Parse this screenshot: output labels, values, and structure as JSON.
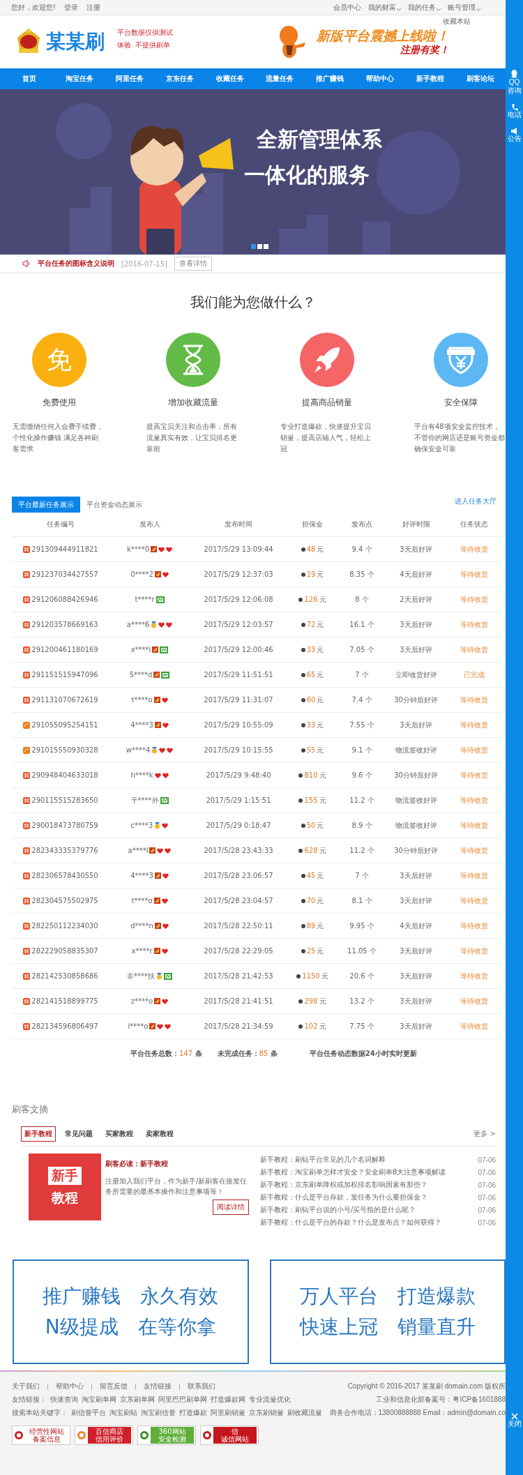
{
  "top_bar": {
    "greeting": "您好，欢迎您!",
    "links": [
      "登录",
      "注册"
    ],
    "menus": [
      {
        "label": "会员中心",
        "dropdown": false
      },
      {
        "label": "我的财富",
        "dropdown": true
      },
      {
        "label": "我的任务",
        "dropdown": true
      },
      {
        "label": "账号管理",
        "dropdown": true
      }
    ],
    "bookmark": "收藏本站"
  },
  "header": {
    "logo": "某某刷",
    "notes": [
      "平台数据仅供测试",
      "体验  不提供刷单"
    ],
    "ad_title": "新版平台震撼上线啦！",
    "ad_subtitle": "注册有奖！"
  },
  "nav": [
    "首页",
    "淘宝任务",
    "阿里任务",
    "京东任务",
    "收藏任务",
    "流量任务",
    "推广赚钱",
    "帮助中心",
    "新手教程",
    "刷客论坛"
  ],
  "hero": {
    "kind": "picture",
    "lines": [
      "全新管理体系",
      "一体化的服务"
    ],
    "slides": [
      {
        "selected": true
      },
      {
        "selected": false
      },
      {
        "selected": false
      }
    ]
  },
  "notice": {
    "title": "平台任务的图标含义说明",
    "date": "[2016-07-15]",
    "button": "查看详情"
  },
  "services": {
    "heading": "我们能为您做什么？",
    "items": [
      {
        "kind": "glyph",
        "glyph": "免",
        "color": "#fbb00f",
        "title": "免费使用",
        "text": "无需缴纳任何入会费手续费，个性化操作赚钱 满足各种刷客需求"
      },
      {
        "kind": "hourglass",
        "color": "#62bb46",
        "title": "增加收藏流量",
        "text": "提高宝贝关注和点击率，所有流量真实有效，让宝贝排名更靠前"
      },
      {
        "kind": "rocket",
        "color": "#f56565",
        "title": "提高商品销量",
        "text": "专业打造爆款，快速提升宝贝销量，提高店铺人气，轻松上冠"
      },
      {
        "kind": "shield",
        "color": "#5cb7f4",
        "title": "安全保障",
        "text": "平台有48项安全监控技术，不管你的网店还是账号资金都确保安全可靠"
      }
    ]
  },
  "tasks": {
    "tabs": [
      {
        "label": "平台最新任务展示",
        "selected": true
      },
      {
        "label": "平台资金动态展示",
        "selected": false
      }
    ],
    "hall_link": "进入任务大厅",
    "columns": [
      "任务编号",
      "发布人",
      "发布时间",
      "担保金",
      "发布点",
      "好评时限",
      "任务状态"
    ],
    "rows": [
      {
        "kind": "shop",
        "id": "291309444911821",
        "publisher": "k****0",
        "badges": [
          {
            "kind": "level"
          },
          {
            "kind": "heart"
          },
          {
            "kind": "heart"
          }
        ],
        "time": "2017/5/29 13:09:44",
        "deposit": "48",
        "unit": "元",
        "points": "9.4 个",
        "review": "3天后好评",
        "status": "等待收货"
      },
      {
        "kind": "shop",
        "id": "291237034427557",
        "publisher": "0****2",
        "badges": [
          {
            "kind": "level"
          },
          {
            "kind": "heart"
          }
        ],
        "time": "2017/5/29 12:37:03",
        "deposit": "19",
        "unit": "元",
        "points": "8.35 个",
        "review": "4天后好评",
        "status": "等待收货"
      },
      {
        "kind": "shop",
        "id": "291206088426946",
        "publisher": "t****r",
        "badges": [
          {
            "kind": "crown"
          }
        ],
        "time": "2017/5/29 12:06:08",
        "deposit": "126",
        "unit": "元",
        "points": "8 个",
        "review": "2天后好评",
        "status": "等待收货"
      },
      {
        "kind": "shop",
        "id": "291203578669163",
        "publisher": "a****6",
        "badges": [
          {
            "kind": "medal"
          },
          {
            "kind": "heart"
          },
          {
            "kind": "heart"
          }
        ],
        "time": "2017/5/29 12:03:57",
        "deposit": "72",
        "unit": "元",
        "points": "16.1 个",
        "review": "3天后好评",
        "status": "等待收货"
      },
      {
        "kind": "shop",
        "id": "291200461180169",
        "publisher": "x****i",
        "badges": [
          {
            "kind": "level"
          },
          {
            "kind": "crown"
          }
        ],
        "time": "2017/5/29 12:00:46",
        "deposit": "33",
        "unit": "元",
        "points": "7.05 个",
        "review": "3天后好评",
        "status": "等待收货"
      },
      {
        "kind": "shop",
        "id": "291151515947096",
        "publisher": "5****d",
        "badges": [
          {
            "kind": "level"
          },
          {
            "kind": "crown"
          }
        ],
        "time": "2017/5/29 11:51:51",
        "deposit": "65",
        "unit": "元",
        "points": "7 个",
        "review": "立即收货好评",
        "status": "已完成"
      },
      {
        "kind": "shop",
        "id": "291131070672619",
        "publisher": "t****o",
        "badges": [
          {
            "kind": "level"
          },
          {
            "kind": "heart"
          }
        ],
        "time": "2017/5/29 11:31:07",
        "deposit": "60",
        "unit": "元",
        "points": "7.4 个",
        "review": "30分钟后好评",
        "status": "等待收货"
      },
      {
        "kind": "mall",
        "id": "291055095254151",
        "publisher": "4****3",
        "badges": [
          {
            "kind": "level"
          },
          {
            "kind": "heart"
          }
        ],
        "time": "2017/5/29 10:55:09",
        "deposit": "33",
        "unit": "元",
        "points": "7.55 个",
        "review": "3天后好评",
        "status": "等待收货"
      },
      {
        "kind": "mall",
        "id": "291015550930328",
        "publisher": "w****4",
        "badges": [
          {
            "kind": "medal"
          },
          {
            "kind": "heart"
          },
          {
            "kind": "heart"
          }
        ],
        "time": "2017/5/29 10:15:55",
        "deposit": "55",
        "unit": "元",
        "points": "9.1 个",
        "review": "物流签收好评",
        "status": "等待收货"
      },
      {
        "kind": "shop",
        "id": "290948404633018",
        "publisher": "h****k",
        "badges": [
          {
            "kind": "heart"
          },
          {
            "kind": "heart"
          }
        ],
        "time": "2017/5/29 9:48:40",
        "deposit": "810",
        "unit": "元",
        "points": "9.6 个",
        "review": "30分钟后好评",
        "status": "等待收货"
      },
      {
        "kind": "shop",
        "id": "290115515283650",
        "publisher": "千****外",
        "badges": [
          {
            "kind": "crown"
          }
        ],
        "time": "2017/5/29 1:15:51",
        "deposit": "155",
        "unit": "元",
        "points": "11.2 个",
        "review": "物流签收好评",
        "status": "等待收货"
      },
      {
        "kind": "shop",
        "id": "290018473780759",
        "publisher": "c****3",
        "badges": [
          {
            "kind": "medal"
          },
          {
            "kind": "heart"
          }
        ],
        "time": "2017/5/29 0:18:47",
        "deposit": "50",
        "unit": "元",
        "points": "8.9 个",
        "review": "物流签收好评",
        "status": "等待收货"
      },
      {
        "kind": "shop",
        "id": "282343335379776",
        "publisher": "a****l",
        "badges": [
          {
            "kind": "level"
          },
          {
            "kind": "heart"
          },
          {
            "kind": "heart"
          }
        ],
        "time": "2017/5/28 23:43:33",
        "deposit": "628",
        "unit": "元",
        "points": "11.2 个",
        "review": "30分钟后好评",
        "status": "等待收货"
      },
      {
        "kind": "shop",
        "id": "282306578430550",
        "publisher": "4****3",
        "badges": [
          {
            "kind": "level"
          },
          {
            "kind": "heart"
          }
        ],
        "time": "2017/5/28 23:06:57",
        "deposit": "45",
        "unit": "元",
        "points": "7 个",
        "review": "3天后好评",
        "status": "等待收货"
      },
      {
        "kind": "shop",
        "id": "282304575502975",
        "publisher": "t****o",
        "badges": [
          {
            "kind": "level"
          },
          {
            "kind": "heart"
          }
        ],
        "time": "2017/5/28 23:04:57",
        "deposit": "70",
        "unit": "元",
        "points": "8.1 个",
        "review": "3天后好评",
        "status": "等待收货"
      },
      {
        "kind": "shop",
        "id": "282250112234030",
        "publisher": "d****n",
        "badges": [
          {
            "kind": "level"
          },
          {
            "kind": "heart"
          }
        ],
        "time": "2017/5/28 22:50:11",
        "deposit": "89",
        "unit": "元",
        "points": "9.95 个",
        "review": "4天后好评",
        "status": "等待收货"
      },
      {
        "kind": "shop",
        "id": "282229058835307",
        "publisher": "x****r",
        "badges": [
          {
            "kind": "level"
          },
          {
            "kind": "heart"
          }
        ],
        "time": "2017/5/28 22:29:05",
        "deposit": "25",
        "unit": "元",
        "points": "11.05 个",
        "review": "3天后好评",
        "status": "等待收货"
      },
      {
        "kind": "shop",
        "id": "282142530858686",
        "publisher": "非****扶",
        "badges": [
          {
            "kind": "medal"
          },
          {
            "kind": "crown"
          }
        ],
        "time": "2017/5/28 21:42:53",
        "deposit": "1150",
        "unit": "元",
        "points": "20.6 个",
        "review": "3天后好评",
        "status": "等待收货"
      },
      {
        "kind": "shop",
        "id": "282141518899775",
        "publisher": "z****o",
        "badges": [
          {
            "kind": "level"
          },
          {
            "kind": "heart"
          }
        ],
        "time": "2017/5/28 21:41:51",
        "deposit": "298",
        "unit": "元",
        "points": "13.2 个",
        "review": "3天后好评",
        "status": "等待收货"
      },
      {
        "kind": "shop",
        "id": "282134596806497",
        "publisher": "l****o",
        "badges": [
          {
            "kind": "level"
          },
          {
            "kind": "heart"
          },
          {
            "kind": "heart"
          }
        ],
        "time": "2017/5/28 21:34:59",
        "deposit": "102",
        "unit": "元",
        "points": "7.75 个",
        "review": "3天后好评",
        "status": "等待收货"
      }
    ],
    "stats": [
      {
        "label": "平台任务总数：",
        "value": "147",
        "unit": "条"
      },
      {
        "label": "未完成任务：",
        "value": "85",
        "unit": "条"
      }
    ],
    "stats_note": "平台任务动态数据24小时实时更新"
  },
  "articles": {
    "title": "刷客文摘",
    "tabs": [
      {
        "label": "新手教程",
        "selected": true
      },
      {
        "label": "常见问题",
        "selected": false
      },
      {
        "label": "买家教程",
        "selected": false
      },
      {
        "label": "卖家教程",
        "selected": false
      }
    ],
    "more": "更多 >",
    "featured": {
      "image_lines": [
        "新手",
        "教程"
      ],
      "title": "刷客必读：新手教程",
      "text": "注册加入我们平台，作为新手/新刷客在接发任务所需要的最基本操作和注意事项等！",
      "button": "阅读详情"
    },
    "list": [
      {
        "title": "新手教程：刷钻平台常见的几个名词解释",
        "date": "07-06"
      },
      {
        "title": "新手教程：淘宝刷单怎样才安全？安全刷单8大注意事项解读",
        "date": "07-06"
      },
      {
        "title": "新手教程：京东刷单降权或加权排名影响因素有那些？",
        "date": "07-06"
      },
      {
        "title": "新手教程：什么是平台存款，发任务为什么要担保金？",
        "date": "07-06"
      },
      {
        "title": "新手教程：刷钻平台说的小号/买号指的是什么呢？",
        "date": "07-06"
      },
      {
        "title": "新手教程：什么是平台的存款？什么是发布点？如何获得？",
        "date": "07-06"
      }
    ]
  },
  "promos": [
    {
      "lines": [
        [
          "推广赚钱",
          "永久有效"
        ],
        [
          "N级提成",
          "在等你拿"
        ]
      ]
    },
    {
      "lines": [
        [
          "万人平台",
          "打造爆款"
        ],
        [
          "快速上冠",
          "销量直升"
        ]
      ]
    }
  ],
  "footer": {
    "links": [
      "关于我们",
      "帮助中心",
      "留言反馈",
      "友情链接",
      "联系我们"
    ],
    "friend_label": "友情链接：",
    "friends": [
      "快速查询",
      "淘宝刷单网",
      "京东刷单网",
      "阿里巴巴刷单网",
      "打造爆款网",
      "专业流量优化"
    ],
    "keyword_label": "搜索本站关键字：",
    "keywords": [
      "刷信誉平台",
      "淘宝刷钻",
      "淘宝刷信誉",
      "打造爆款",
      "阿里刷销量",
      "京东刷销量",
      "刷收藏流量"
    ],
    "badges": [
      {
        "kind": "gov",
        "lines": [
          "经营性网站",
          "备案信息"
        ]
      },
      {
        "kind": "credit",
        "lines": [
          "百信商店",
          "信用评价"
        ]
      },
      {
        "kind": "safe",
        "lines": [
          "360网站",
          "安全检测"
        ]
      },
      {
        "kind": "trust",
        "lines": [
          "信",
          "诚信网站"
        ]
      }
    ],
    "copyright": "Copyright © 2016-2017 某某刷  domain.com 版权所",
    "icp": "工业和信息化部备案号：粤ICP备1601888",
    "contact": "商务合作电话：13800888888  Email：admin@domain.co"
  },
  "side_bar": {
    "items": [
      {
        "kind": "qq",
        "label": "QQ咨询"
      },
      {
        "kind": "phone",
        "label": "电话"
      },
      {
        "kind": "notice",
        "label": "公告"
      }
    ],
    "close": "关闭"
  }
}
